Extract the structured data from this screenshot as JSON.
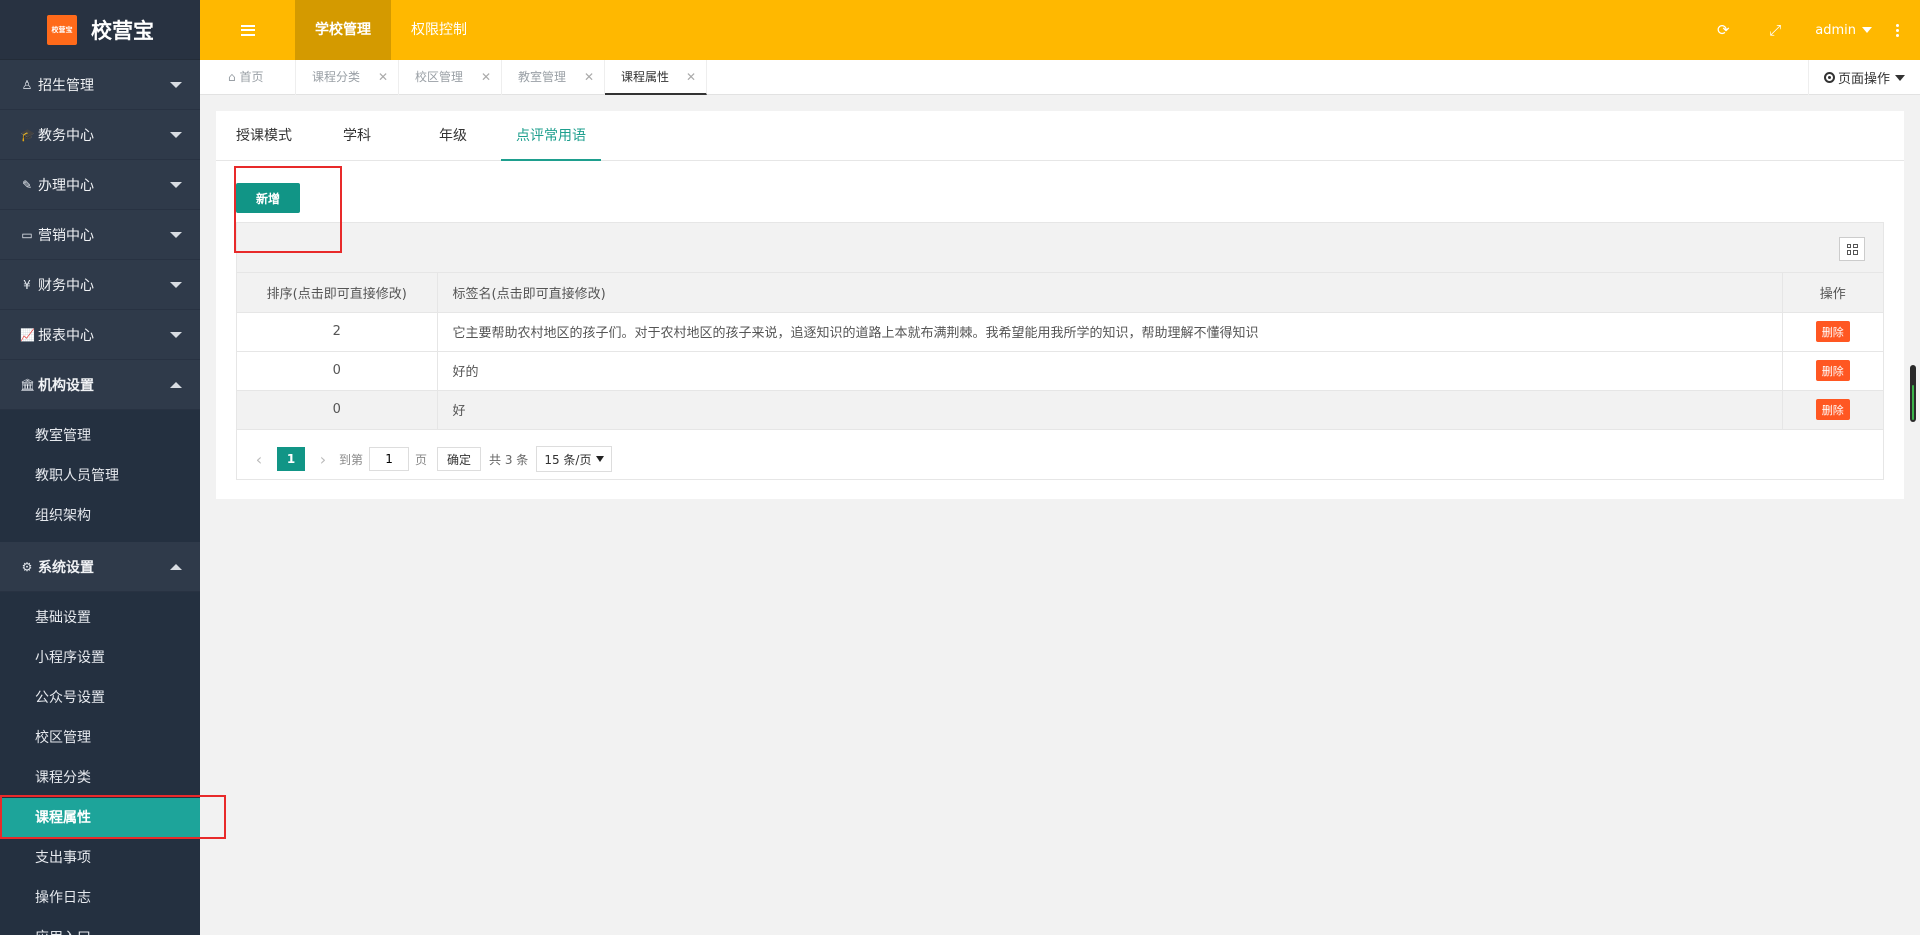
{
  "app": {
    "logo_text": "校营宝",
    "logo_badge": "校营宝"
  },
  "icons": {
    "sidebar_bg": "#2f3a4a",
    "header_bg": "#ffb800",
    "accent": "#119586",
    "danger": "#ff5722"
  },
  "sidebar": {
    "groups": [
      {
        "label": "招生管理",
        "icon": "person-icon",
        "glyph": "♙",
        "open": false
      },
      {
        "label": "教务中心",
        "icon": "graduation-cap-icon",
        "glyph": "🎓",
        "open": false
      },
      {
        "label": "办理中心",
        "icon": "edit-icon",
        "glyph": "✎",
        "open": false
      },
      {
        "label": "营销中心",
        "icon": "laptop-icon",
        "glyph": "▭",
        "open": false
      },
      {
        "label": "财务中心",
        "icon": "yen-icon",
        "glyph": "¥",
        "open": false
      },
      {
        "label": "报表中心",
        "icon": "line-chart-icon",
        "glyph": "📈",
        "open": false
      },
      {
        "label": "机构设置",
        "icon": "institution-icon",
        "glyph": "🏛",
        "open": true
      },
      {
        "label": "系统设置",
        "icon": "gears-icon",
        "glyph": "⚙",
        "open": true
      }
    ],
    "org_items": [
      "教室管理",
      "教职人员管理",
      "组织架构"
    ],
    "sys_items": [
      "基础设置",
      "小程序设置",
      "公众号设置",
      "校区管理",
      "课程分类",
      "课程属性",
      "支出事项",
      "操作日志",
      "应用入口"
    ]
  },
  "header": {
    "tabs": [
      "学校管理",
      "权限控制"
    ],
    "user": "admin"
  },
  "page_tabs": {
    "home": "首页",
    "tabs": [
      "课程分类",
      "校区管理",
      "教室管理",
      "课程属性"
    ],
    "ops": "页面操作"
  },
  "content": {
    "subtabs": [
      "授课模式",
      "学科",
      "年级",
      "点评常用语"
    ],
    "add_button": "新增",
    "table": {
      "headers": [
        "排序(点击即可直接修改)",
        "标签名(点击即可直接修改)",
        "操作"
      ],
      "rows": [
        {
          "order": "2",
          "label": "它主要帮助农村地区的孩子们。对于农村地区的孩子来说，追逐知识的道路上本就布满荆棘。我希望能用我所学的知识，帮助理解不懂得知识",
          "action": "删除"
        },
        {
          "order": "0",
          "label": "好的",
          "action": "删除"
        },
        {
          "order": "0",
          "label": "好",
          "action": "删除"
        }
      ]
    },
    "pager": {
      "current": "1",
      "goto_prefix": "到第",
      "goto_value": "1",
      "goto_suffix": "页",
      "confirm": "确定",
      "total": "共 3 条",
      "page_size": "15 条/页"
    }
  }
}
